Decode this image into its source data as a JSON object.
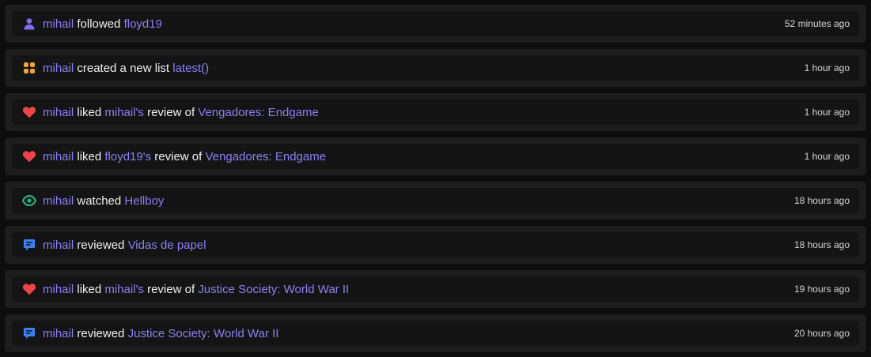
{
  "colors": {
    "link": "#8b80f5",
    "user_icon": "#7b6ff2",
    "list_icon": "#f2a23a",
    "heart_icon": "#ef4444",
    "eye_icon": "#22b07d",
    "review_icon": "#3b82f6"
  },
  "activities": [
    {
      "icon": "user-icon",
      "actor": "mihail",
      "parts": [
        " followed ",
        "floyd19"
      ],
      "time": "52 minutes ago"
    },
    {
      "icon": "list-icon",
      "actor": "mihail",
      "parts": [
        " created a new list ",
        "latest()"
      ],
      "time": "1 hour ago"
    },
    {
      "icon": "heart-icon",
      "actor": "mihail",
      "parts": [
        " liked ",
        "mihail's",
        " review of ",
        "Vengadores: Endgame"
      ],
      "time": "1 hour ago"
    },
    {
      "icon": "heart-icon",
      "actor": "mihail",
      "parts": [
        " liked ",
        "floyd19's",
        " review of ",
        "Vengadores: Endgame"
      ],
      "time": "1 hour ago"
    },
    {
      "icon": "eye-icon",
      "actor": "mihail",
      "parts": [
        " watched ",
        "Hellboy"
      ],
      "time": "18 hours ago"
    },
    {
      "icon": "review-icon",
      "actor": "mihail",
      "parts": [
        " reviewed ",
        "Vidas de papel"
      ],
      "time": "18 hours ago"
    },
    {
      "icon": "heart-icon",
      "actor": "mihail",
      "parts": [
        " liked ",
        "mihail's",
        " review of ",
        "Justice Society: World War II"
      ],
      "time": "19 hours ago"
    },
    {
      "icon": "review-icon",
      "actor": "mihail",
      "parts": [
        " reviewed ",
        "Justice Society: World War II"
      ],
      "time": "20 hours ago"
    }
  ]
}
